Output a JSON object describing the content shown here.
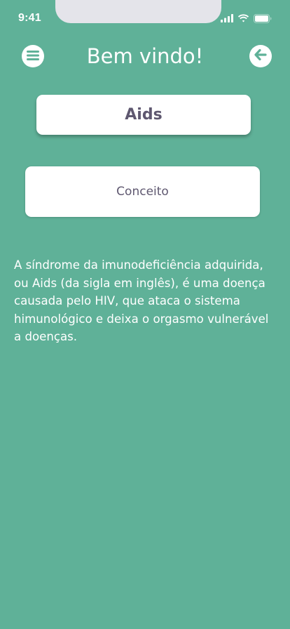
{
  "status_bar": {
    "time": "9:41",
    "icons": [
      "signal-icon",
      "wifi-icon",
      "battery-icon"
    ]
  },
  "header": {
    "title": "Bem vindo!",
    "menu_icon": "menu-icon",
    "back_icon": "arrow-left-icon"
  },
  "topic": {
    "label": "Aids"
  },
  "section": {
    "label": "Conceito"
  },
  "description": {
    "lines": [
      "A síndrome da imunodeficiência adquirida,",
      "ou Aids (da sigla em inglês), é uma doença",
      "causada pelo HIV, que ataca o sistema",
      "himunológico e deixa o orgasmo vulnerável",
      "a doenças."
    ]
  },
  "colors": {
    "background": "#5fb198",
    "card": "#ffffff",
    "card_text": "#5f5870",
    "text": "#ffffff"
  }
}
